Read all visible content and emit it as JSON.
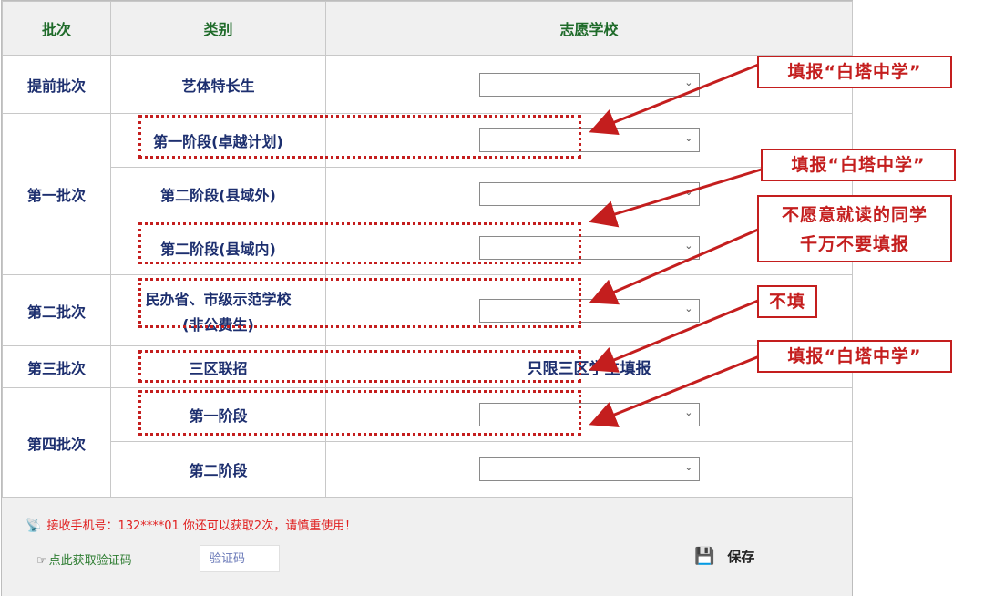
{
  "header": {
    "col_batch": "批次",
    "col_category": "类别",
    "col_school": "志愿学校"
  },
  "rows": {
    "early": {
      "batch": "提前批次",
      "category": "艺体特长生"
    },
    "first": {
      "batch": "第一批次",
      "cat1": "第一阶段(卓越计划)",
      "cat2": "第二阶段(县域外)",
      "cat3": "第二阶段(县域内)"
    },
    "second": {
      "batch": "第二批次",
      "cat_line1": "民办省、市级示范学校",
      "cat_line2": "(非公费生)"
    },
    "third": {
      "batch": "第三批次",
      "category": "三区联招",
      "note": "只限三区学生填报"
    },
    "fourth": {
      "batch": "第四批次",
      "cat1": "第一阶段",
      "cat2": "第二阶段"
    }
  },
  "select_chevron": "⌄",
  "footer": {
    "phone_text": "接收手机号：132****01   你还可以获取2次，请慎重使用！",
    "get_code_link": "点此获取验证码",
    "code_placeholder": "验证码",
    "save_label": "保存"
  },
  "callouts": {
    "c1": "填报“白塔中学”",
    "c2": "填报“白塔中学”",
    "c3_line1": "不愿意就读的同学",
    "c3_line2": "千万不要填报",
    "c4": "不填",
    "c5": "填报“白塔中学”"
  },
  "colors": {
    "accent_red": "#c41e1e",
    "header_green": "#1f6b2a",
    "navy_text": "#1d2f6f"
  },
  "icons": {
    "satellite": "satellite-icon",
    "hand": "pointing-hand-icon",
    "save": "floppy-disk-icon"
  }
}
